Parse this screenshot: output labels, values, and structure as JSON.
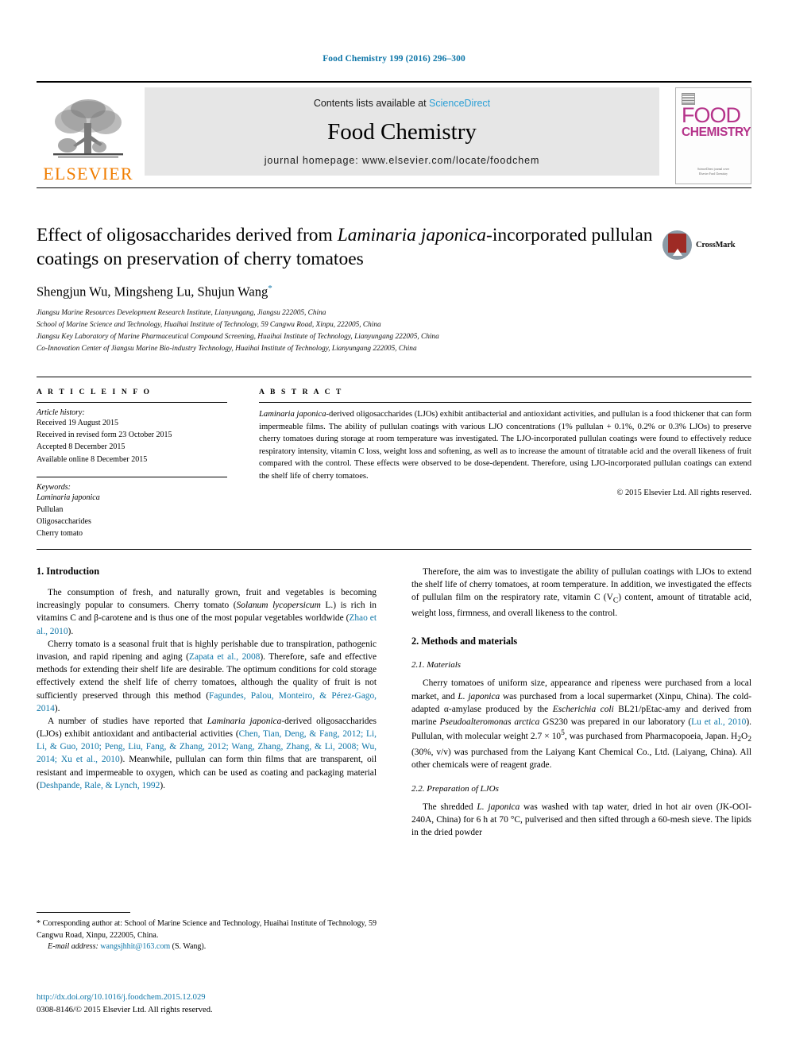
{
  "running_head": "Food Chemistry 199 (2016) 296–300",
  "masthead": {
    "contents_prefix": "Contents lists available at ",
    "sciencedirect": "ScienceDirect",
    "journal_name": "Food Chemistry",
    "homepage": "journal homepage: www.elsevier.com/locate/foodchem",
    "publisher_logo_word": "ELSEVIER",
    "cover": {
      "word_food": "FOOD",
      "word_chemistry": "CHEMISTRY",
      "footer_line1": "ScienceDirect  journal  cover",
      "footer_line2": "Elsevier  Food  Chemistry"
    },
    "colors": {
      "band_background": "#e6e6e6",
      "link_blue": "#2a9fd6",
      "elsevier_orange": "#f07d00",
      "cover_magenta": "#b5338a"
    }
  },
  "title": {
    "line1_pre": "Effect of oligosaccharides derived from ",
    "line1_italic": "Laminaria japonica",
    "line1_post": "-incorporated",
    "line2": "pullulan coatings on preservation of cherry tomatoes"
  },
  "crossmark": {
    "label": "CrossMark"
  },
  "authors": {
    "names": "Shengjun Wu, Mingsheng Lu, Shujun Wang",
    "corresponding_marker": "*"
  },
  "affiliations": [
    "Jiangsu Marine Resources Development Research Institute, Lianyungang, Jiangsu 222005, China",
    "School of Marine Science and Technology, Huaihai Institute of Technology, 59 Cangwu Road, Xinpu, 222005, China",
    "Jiangsu Key Laboratory of Marine Pharmaceutical Compound Screening, Huaihai Institute of Technology, Lianyungang 222005, China",
    "Co-Innovation Center of Jiangsu Marine Bio-industry Technology, Huaihai Institute of Technology, Lianyungang 222005, China"
  ],
  "article_info": {
    "heading": "A R T I C L E    I N F O",
    "history_label": "Article history:",
    "history": [
      "Received 19 August 2015",
      "Received in revised form 23 October 2015",
      "Accepted 8 December 2015",
      "Available online 8 December 2015"
    ],
    "keywords_label": "Keywords:",
    "keywords": [
      "Laminaria japonica",
      "Pullulan",
      "Oligosaccharides",
      "Cherry tomato"
    ]
  },
  "abstract": {
    "heading": "A B S T R A C T",
    "italic_lead": "Laminaria japonica",
    "body": "-derived oligosaccharides (LJOs) exhibit antibacterial and antioxidant activities, and pullulan is a food thickener that can form impermeable films. The ability of pullulan coatings with various LJO concentrations (1% pullulan + 0.1%, 0.2% or 0.3% LJOs) to preserve cherry tomatoes during storage at room temperature was investigated. The LJO-incorporated pullulan coatings were found to effectively reduce respiratory intensity, vitamin C loss, weight loss and softening, as well as to increase the amount of titratable acid and the overall likeness of fruit compared with the control. These effects were observed to be dose-dependent. Therefore, using LJO-incorporated pullulan coatings can extend the shelf life of cherry tomatoes.",
    "copyright": "© 2015 Elsevier Ltd. All rights reserved."
  },
  "left_column": {
    "section_heading": "1. Introduction",
    "paragraphs": [
      {
        "parts": [
          {
            "t": "The consumption of fresh, and naturally grown, fruit and vegetables is becoming increasingly popular to consumers. Cherry tomato ("
          },
          {
            "t": "Solanum lycopersicum",
            "s": "ital"
          },
          {
            "t": " L.) is rich in vitamins C and β-carotene and is thus one of the most popular vegetables worldwide ("
          },
          {
            "t": "Zhao et al., 2010",
            "s": "cite"
          },
          {
            "t": ")."
          }
        ]
      },
      {
        "parts": [
          {
            "t": "Cherry tomato is a seasonal fruit that is highly perishable due to transpiration, pathogenic invasion, and rapid ripening and aging ("
          },
          {
            "t": "Zapata et al., 2008",
            "s": "cite"
          },
          {
            "t": "). Therefore, safe and effective methods for extending their shelf life are desirable. The optimum conditions for cold storage effectively extend the shelf life of cherry tomatoes, although the quality of fruit is not sufficiently preserved through this method ("
          },
          {
            "t": "Fagundes, Palou, Monteiro, & Pérez-Gago, 2014",
            "s": "cite"
          },
          {
            "t": ")."
          }
        ]
      },
      {
        "parts": [
          {
            "t": "A number of studies have reported that "
          },
          {
            "t": "Laminaria japonica",
            "s": "ital"
          },
          {
            "t": "-derived oligosaccharides (LJOs) exhibit antioxidant and antibacterial activities ("
          },
          {
            "t": "Chen, Tian, Deng, & Fang, 2012; Li, Li, & Guo, 2010; Peng, Liu, Fang, & Zhang, 2012; Wang, Zhang, Zhang, & Li, 2008; Wu, 2014; Xu et al., 2010",
            "s": "cite"
          },
          {
            "t": "). Meanwhile, pullulan can form thin films that are transparent, oil resistant and impermeable to oxygen, which can be used as coating and packaging material ("
          },
          {
            "t": "Deshpande, Rale, & Lynch, 1992",
            "s": "cite"
          },
          {
            "t": ")."
          }
        ]
      }
    ]
  },
  "right_column": {
    "intro_paragraph": {
      "parts": [
        {
          "t": "Therefore, the aim was to investigate the ability of pullulan coatings with LJOs to extend the shelf life of cherry tomatoes, at room temperature. In addition, we investigated the effects of pullulan film on the respiratory rate, vitamin C (V"
        },
        {
          "t": "C",
          "s": "sub"
        },
        {
          "t": ") content, amount of titratable acid, weight loss, firmness, and overall likeness to the control."
        }
      ]
    },
    "methods_heading": "2. Methods and materials",
    "materials_heading": "2.1. Materials",
    "materials_paragraph": {
      "parts": [
        {
          "t": "Cherry tomatoes of uniform size, appearance and ripeness were purchased from a local market, and "
        },
        {
          "t": "L. japonica",
          "s": "ital"
        },
        {
          "t": " was purchased from a local supermarket (Xinpu, China). The cold-adapted α-amylase produced by the "
        },
        {
          "t": "Escherichia coli",
          "s": "ital"
        },
        {
          "t": " BL21/pEtac-amy and derived from marine "
        },
        {
          "t": "Pseudoalteromonas arctica",
          "s": "ital"
        },
        {
          "t": " GS230 was prepared in our laboratory ("
        },
        {
          "t": "Lu et al., 2010",
          "s": "cite"
        },
        {
          "t": "). Pullulan, with molecular weight 2.7 × 10"
        },
        {
          "t": "5",
          "s": "sup"
        },
        {
          "t": ", was purchased from Pharmacopoeia, Japan. H"
        },
        {
          "t": "2",
          "s": "sub"
        },
        {
          "t": "O"
        },
        {
          "t": "2",
          "s": "sub"
        },
        {
          "t": " (30%, v/v) was purchased from the Laiyang Kant Chemical Co., Ltd. (Laiyang, China). All other chemicals were of reagent grade."
        }
      ]
    },
    "ljos_heading": "2.2. Preparation of LJOs",
    "ljos_paragraph": {
      "parts": [
        {
          "t": "The shredded "
        },
        {
          "t": "L. japonica",
          "s": "ital"
        },
        {
          "t": " was washed with tap water, dried in hot air oven (JK-OOI-240A, China) for 6 h at 70 °C, pulverised and then sifted through a 60-mesh sieve. The lipids in the dried powder"
        }
      ]
    }
  },
  "footnote": {
    "marker": "*",
    "text": " Corresponding author at: School of Marine Science and Technology, Huaihai Institute of Technology, 59 Cangwu Road, Xinpu, 222005, China.",
    "email_label": "E-mail address:",
    "email": "wangsjhhit@163.com",
    "email_owner": "(S. Wang)."
  },
  "doi_block": {
    "doi": "http://dx.doi.org/10.1016/j.foodchem.2015.12.029",
    "issn_line": "0308-8146/© 2015 Elsevier Ltd. All rights reserved."
  }
}
